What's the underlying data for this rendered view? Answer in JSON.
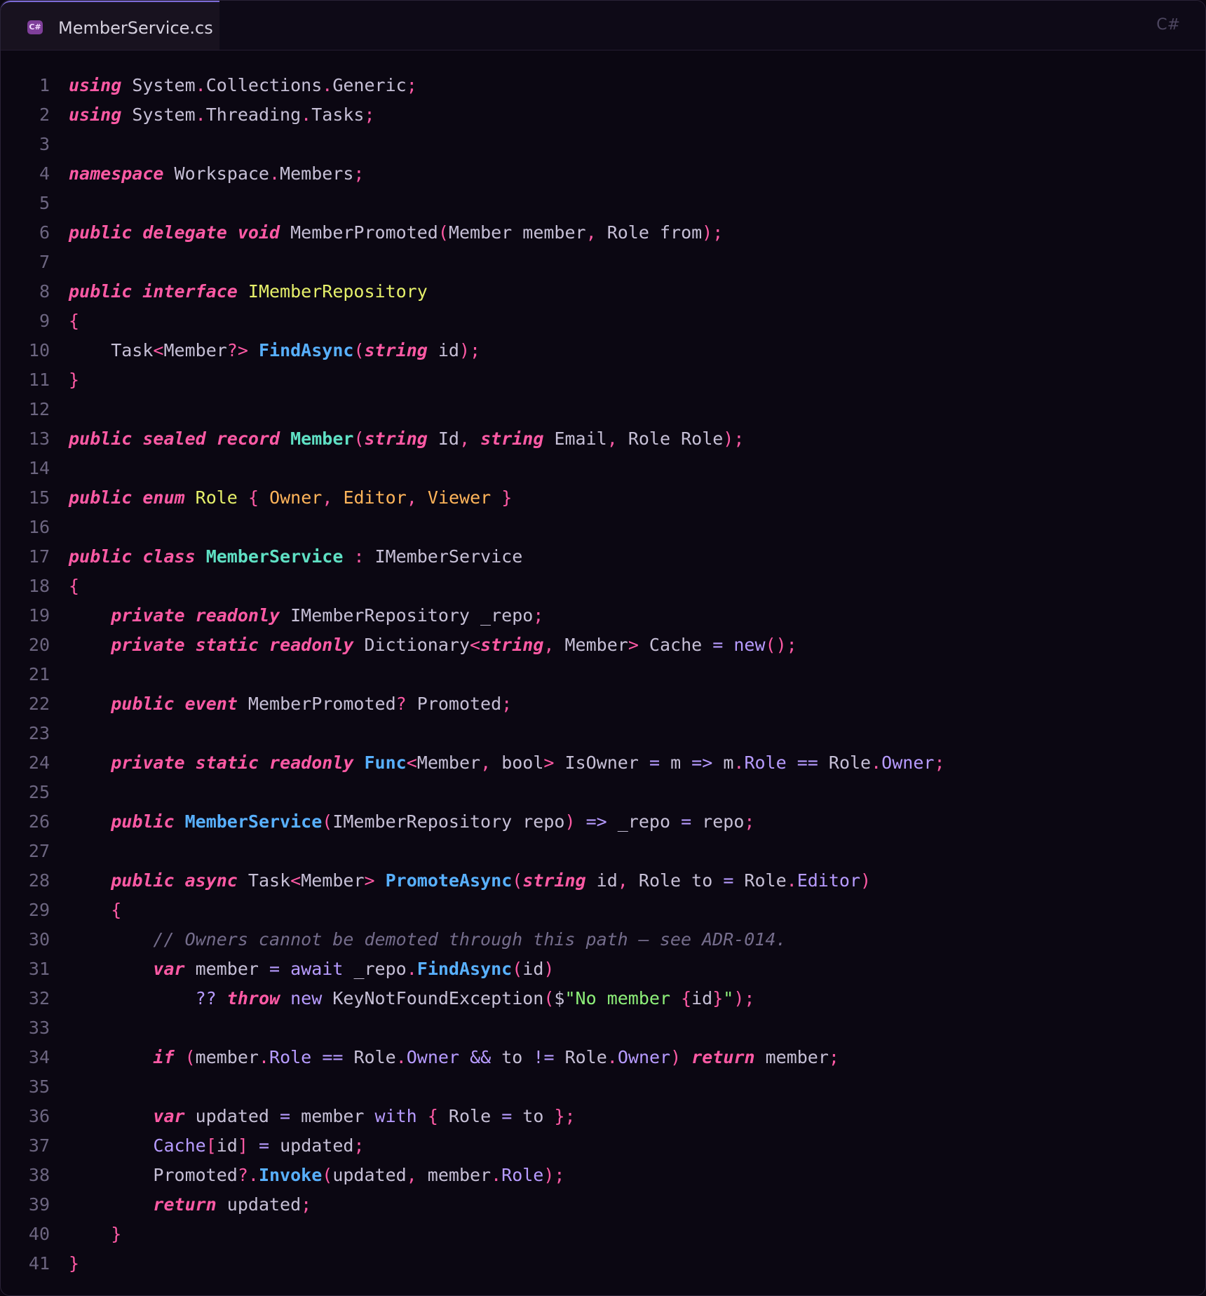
{
  "tab": {
    "badge": "C#",
    "filename": "MemberService.cs"
  },
  "language_label": "C#",
  "colors": {
    "keyword": "#ff5aa5",
    "function": "#58b0ff",
    "type": "#5fe0c4",
    "interface": "#e6f06a",
    "enum_member": "#ffb45a",
    "property": "#b79bff",
    "string": "#8ef07a",
    "comment": "#756d8c",
    "plain": "#c6bfd6"
  },
  "lines": [
    [
      [
        "kw",
        "using"
      ],
      [
        "pl",
        " System"
      ],
      [
        "pu",
        "."
      ],
      [
        "pl",
        "Collections"
      ],
      [
        "pu",
        "."
      ],
      [
        "pl",
        "Generic"
      ],
      [
        "pu",
        ";"
      ]
    ],
    [
      [
        "kw",
        "using"
      ],
      [
        "pl",
        " System"
      ],
      [
        "pu",
        "."
      ],
      [
        "pl",
        "Threading"
      ],
      [
        "pu",
        "."
      ],
      [
        "pl",
        "Tasks"
      ],
      [
        "pu",
        ";"
      ]
    ],
    [],
    [
      [
        "kw",
        "namespace"
      ],
      [
        "pl",
        " Workspace"
      ],
      [
        "pu",
        "."
      ],
      [
        "pl",
        "Members"
      ],
      [
        "pu",
        ";"
      ]
    ],
    [],
    [
      [
        "kw",
        "public"
      ],
      [
        "pl",
        " "
      ],
      [
        "kw",
        "delegate"
      ],
      [
        "pl",
        " "
      ],
      [
        "kw",
        "void"
      ],
      [
        "pl",
        " MemberPromoted"
      ],
      [
        "pu",
        "("
      ],
      [
        "pl",
        "Member member"
      ],
      [
        "pu",
        ","
      ],
      [
        "pl",
        " Role from"
      ],
      [
        "pu",
        ");"
      ]
    ],
    [],
    [
      [
        "kw",
        "public"
      ],
      [
        "pl",
        " "
      ],
      [
        "kw",
        "interface"
      ],
      [
        "pl",
        " "
      ],
      [
        "iface",
        "IMemberRepository"
      ]
    ],
    [
      [
        "br",
        "{"
      ]
    ],
    [
      [
        "pl",
        "    Task"
      ],
      [
        "pu",
        "<"
      ],
      [
        "pl",
        "Member"
      ],
      [
        "pu",
        "?>"
      ],
      [
        "pl",
        " "
      ],
      [
        "fn",
        "FindAsync"
      ],
      [
        "pu",
        "("
      ],
      [
        "kw",
        "string"
      ],
      [
        "pl",
        " id"
      ],
      [
        "pu",
        ");"
      ]
    ],
    [
      [
        "br",
        "}"
      ]
    ],
    [],
    [
      [
        "kw",
        "public"
      ],
      [
        "pl",
        " "
      ],
      [
        "kw",
        "sealed"
      ],
      [
        "pl",
        " "
      ],
      [
        "kw",
        "record"
      ],
      [
        "pl",
        " "
      ],
      [
        "ty",
        "Member"
      ],
      [
        "pu",
        "("
      ],
      [
        "kw",
        "string"
      ],
      [
        "pl",
        " Id"
      ],
      [
        "pu",
        ","
      ],
      [
        "pl",
        " "
      ],
      [
        "kw",
        "string"
      ],
      [
        "pl",
        " Email"
      ],
      [
        "pu",
        ","
      ],
      [
        "pl",
        " Role Role"
      ],
      [
        "pu",
        ");"
      ]
    ],
    [],
    [
      [
        "kw",
        "public"
      ],
      [
        "pl",
        " "
      ],
      [
        "kw",
        "enum"
      ],
      [
        "pl",
        " "
      ],
      [
        "iface",
        "Role"
      ],
      [
        "pl",
        " "
      ],
      [
        "br",
        "{"
      ],
      [
        "pl",
        " "
      ],
      [
        "en",
        "Owner"
      ],
      [
        "pu",
        ","
      ],
      [
        "pl",
        " "
      ],
      [
        "en",
        "Editor"
      ],
      [
        "pu",
        ","
      ],
      [
        "pl",
        " "
      ],
      [
        "en",
        "Viewer"
      ],
      [
        "pl",
        " "
      ],
      [
        "br",
        "}"
      ]
    ],
    [],
    [
      [
        "kw",
        "public"
      ],
      [
        "pl",
        " "
      ],
      [
        "kw",
        "class"
      ],
      [
        "pl",
        " "
      ],
      [
        "ty",
        "MemberService"
      ],
      [
        "pl",
        " "
      ],
      [
        "pu",
        ":"
      ],
      [
        "pl",
        " IMemberService"
      ]
    ],
    [
      [
        "br",
        "{"
      ]
    ],
    [
      [
        "pl",
        "    "
      ],
      [
        "kw",
        "private"
      ],
      [
        "pl",
        " "
      ],
      [
        "kw",
        "readonly"
      ],
      [
        "pl",
        " IMemberRepository _repo"
      ],
      [
        "pu",
        ";"
      ]
    ],
    [
      [
        "pl",
        "    "
      ],
      [
        "kw",
        "private"
      ],
      [
        "pl",
        " "
      ],
      [
        "kw",
        "static"
      ],
      [
        "pl",
        " "
      ],
      [
        "kw",
        "readonly"
      ],
      [
        "pl",
        " Dictionary"
      ],
      [
        "pu",
        "<"
      ],
      [
        "kw",
        "string"
      ],
      [
        "pu",
        ","
      ],
      [
        "pl",
        " Member"
      ],
      [
        "pu",
        ">"
      ],
      [
        "pl",
        " Cache "
      ],
      [
        "op",
        "="
      ],
      [
        "pl",
        " "
      ],
      [
        "op",
        "new"
      ],
      [
        "pu",
        "();"
      ]
    ],
    [],
    [
      [
        "pl",
        "    "
      ],
      [
        "kw",
        "public"
      ],
      [
        "pl",
        " "
      ],
      [
        "kw",
        "event"
      ],
      [
        "pl",
        " MemberPromoted"
      ],
      [
        "pu",
        "?"
      ],
      [
        "pl",
        " Promoted"
      ],
      [
        "pu",
        ";"
      ]
    ],
    [],
    [
      [
        "pl",
        "    "
      ],
      [
        "kw",
        "private"
      ],
      [
        "pl",
        " "
      ],
      [
        "kw",
        "static"
      ],
      [
        "pl",
        " "
      ],
      [
        "kw",
        "readonly"
      ],
      [
        "pl",
        " "
      ],
      [
        "fn",
        "Func"
      ],
      [
        "pu",
        "<"
      ],
      [
        "pl",
        "Member"
      ],
      [
        "pu",
        ","
      ],
      [
        "pl",
        " bool"
      ],
      [
        "pu",
        ">"
      ],
      [
        "pl",
        " IsOwner "
      ],
      [
        "op",
        "="
      ],
      [
        "pl",
        " m "
      ],
      [
        "op",
        "=>"
      ],
      [
        "pl",
        " m"
      ],
      [
        "pu",
        "."
      ],
      [
        "pr",
        "Role"
      ],
      [
        "pl",
        " "
      ],
      [
        "op",
        "=="
      ],
      [
        "pl",
        " Role"
      ],
      [
        "pu",
        "."
      ],
      [
        "pr",
        "Owner"
      ],
      [
        "pu",
        ";"
      ]
    ],
    [],
    [
      [
        "pl",
        "    "
      ],
      [
        "kw",
        "public"
      ],
      [
        "pl",
        " "
      ],
      [
        "fn",
        "MemberService"
      ],
      [
        "pu",
        "("
      ],
      [
        "pl",
        "IMemberRepository repo"
      ],
      [
        "pu",
        ")"
      ],
      [
        "pl",
        " "
      ],
      [
        "op",
        "=>"
      ],
      [
        "pl",
        " _repo "
      ],
      [
        "op",
        "="
      ],
      [
        "pl",
        " repo"
      ],
      [
        "pu",
        ";"
      ]
    ],
    [],
    [
      [
        "pl",
        "    "
      ],
      [
        "kw",
        "public"
      ],
      [
        "pl",
        " "
      ],
      [
        "kw",
        "async"
      ],
      [
        "pl",
        " Task"
      ],
      [
        "pu",
        "<"
      ],
      [
        "pl",
        "Member"
      ],
      [
        "pu",
        ">"
      ],
      [
        "pl",
        " "
      ],
      [
        "fn",
        "PromoteAsync"
      ],
      [
        "pu",
        "("
      ],
      [
        "kw",
        "string"
      ],
      [
        "pl",
        " id"
      ],
      [
        "pu",
        ","
      ],
      [
        "pl",
        " Role to "
      ],
      [
        "op",
        "="
      ],
      [
        "pl",
        " Role"
      ],
      [
        "pu",
        "."
      ],
      [
        "pr",
        "Editor"
      ],
      [
        "pu",
        ")"
      ]
    ],
    [
      [
        "pl",
        "    "
      ],
      [
        "br",
        "{"
      ]
    ],
    [
      [
        "pl",
        "        "
      ],
      [
        "cm",
        "// Owners cannot be demoted through this path — see ADR-014."
      ]
    ],
    [
      [
        "pl",
        "        "
      ],
      [
        "kw",
        "var"
      ],
      [
        "pl",
        " member "
      ],
      [
        "op",
        "="
      ],
      [
        "pl",
        " "
      ],
      [
        "op",
        "await"
      ],
      [
        "pl",
        " _repo"
      ],
      [
        "pu",
        "."
      ],
      [
        "fn",
        "FindAsync"
      ],
      [
        "pu",
        "("
      ],
      [
        "pl",
        "id"
      ],
      [
        "pu",
        ")"
      ]
    ],
    [
      [
        "pl",
        "            "
      ],
      [
        "op",
        "??"
      ],
      [
        "pl",
        " "
      ],
      [
        "kw",
        "throw"
      ],
      [
        "pl",
        " "
      ],
      [
        "op",
        "new"
      ],
      [
        "pl",
        " KeyNotFoundException"
      ],
      [
        "pu",
        "("
      ],
      [
        "pl",
        "$"
      ],
      [
        "str",
        "\"No member "
      ],
      [
        "br",
        "{"
      ],
      [
        "pl",
        "id"
      ],
      [
        "br",
        "}"
      ],
      [
        "str",
        "\""
      ],
      [
        "pu",
        ");"
      ]
    ],
    [],
    [
      [
        "pl",
        "        "
      ],
      [
        "kw",
        "if"
      ],
      [
        "pl",
        " "
      ],
      [
        "pu",
        "("
      ],
      [
        "pl",
        "member"
      ],
      [
        "pu",
        "."
      ],
      [
        "pr",
        "Role"
      ],
      [
        "pl",
        " "
      ],
      [
        "op",
        "=="
      ],
      [
        "pl",
        " Role"
      ],
      [
        "pu",
        "."
      ],
      [
        "pr",
        "Owner"
      ],
      [
        "pl",
        " "
      ],
      [
        "op",
        "&&"
      ],
      [
        "pl",
        " to "
      ],
      [
        "op",
        "!="
      ],
      [
        "pl",
        " Role"
      ],
      [
        "pu",
        "."
      ],
      [
        "pr",
        "Owner"
      ],
      [
        "pu",
        ")"
      ],
      [
        "pl",
        " "
      ],
      [
        "kw",
        "return"
      ],
      [
        "pl",
        " member"
      ],
      [
        "pu",
        ";"
      ]
    ],
    [],
    [
      [
        "pl",
        "        "
      ],
      [
        "kw",
        "var"
      ],
      [
        "pl",
        " updated "
      ],
      [
        "op",
        "="
      ],
      [
        "pl",
        " member "
      ],
      [
        "op",
        "with"
      ],
      [
        "pl",
        " "
      ],
      [
        "br",
        "{"
      ],
      [
        "pl",
        " Role "
      ],
      [
        "op",
        "="
      ],
      [
        "pl",
        " to "
      ],
      [
        "br",
        "}"
      ],
      [
        "pu",
        ";"
      ]
    ],
    [
      [
        "pl",
        "        "
      ],
      [
        "pr",
        "Cache"
      ],
      [
        "pu",
        "["
      ],
      [
        "pl",
        "id"
      ],
      [
        "pu",
        "]"
      ],
      [
        "pl",
        " "
      ],
      [
        "op",
        "="
      ],
      [
        "pl",
        " updated"
      ],
      [
        "pu",
        ";"
      ]
    ],
    [
      [
        "pl",
        "        Promoted"
      ],
      [
        "pu",
        "?."
      ],
      [
        "fn",
        "Invoke"
      ],
      [
        "pu",
        "("
      ],
      [
        "pl",
        "updated"
      ],
      [
        "pu",
        ","
      ],
      [
        "pl",
        " member"
      ],
      [
        "pu",
        "."
      ],
      [
        "pr",
        "Role"
      ],
      [
        "pu",
        ");"
      ]
    ],
    [
      [
        "pl",
        "        "
      ],
      [
        "kw",
        "return"
      ],
      [
        "pl",
        " updated"
      ],
      [
        "pu",
        ";"
      ]
    ],
    [
      [
        "pl",
        "    "
      ],
      [
        "br",
        "}"
      ]
    ],
    [
      [
        "br",
        "}"
      ]
    ]
  ]
}
